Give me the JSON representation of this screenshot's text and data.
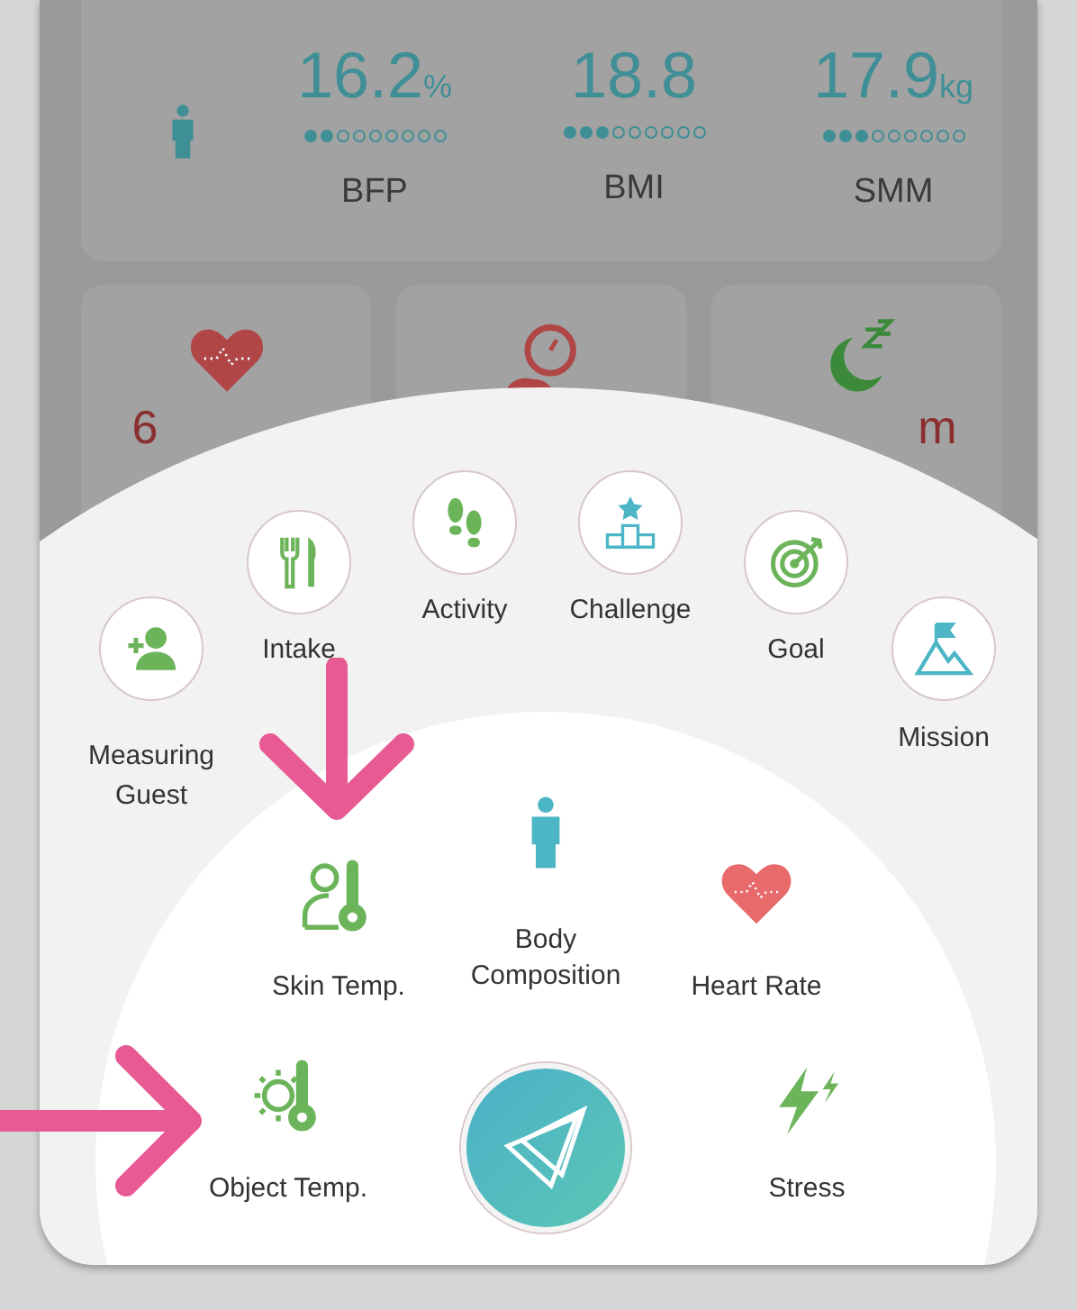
{
  "summary": {
    "metrics": [
      {
        "value": "16.2",
        "unit": "%",
        "level": 0.222,
        "label": "BFP"
      },
      {
        "value": "18.8",
        "level": 0.333,
        "label": "BMI"
      },
      {
        "value": "17.9",
        "unit": "kg",
        "level": 0.333,
        "label": "SMM"
      }
    ]
  },
  "tiles": [
    {
      "kind": "heart",
      "value": "6"
    },
    {
      "kind": "weight"
    },
    {
      "kind": "sleep",
      "value": "m"
    }
  ],
  "menu": {
    "outer": [
      {
        "kind": "guest",
        "label": "Measuring Guest"
      },
      {
        "kind": "intake",
        "label": "Intake"
      },
      {
        "kind": "activity",
        "label": "Activity"
      },
      {
        "kind": "challenge",
        "label": "Challenge"
      },
      {
        "kind": "goal",
        "label": "Goal"
      },
      {
        "kind": "mission",
        "label": "Mission"
      }
    ],
    "inner": [
      {
        "kind": "skin",
        "label": "Skin Temp."
      },
      {
        "kind": "body",
        "label": "Body Composition"
      },
      {
        "kind": "heart",
        "label": "Heart Rate"
      },
      {
        "kind": "object",
        "label": "Object Temp."
      },
      {
        "kind": "stress",
        "label": "Stress"
      }
    ]
  }
}
